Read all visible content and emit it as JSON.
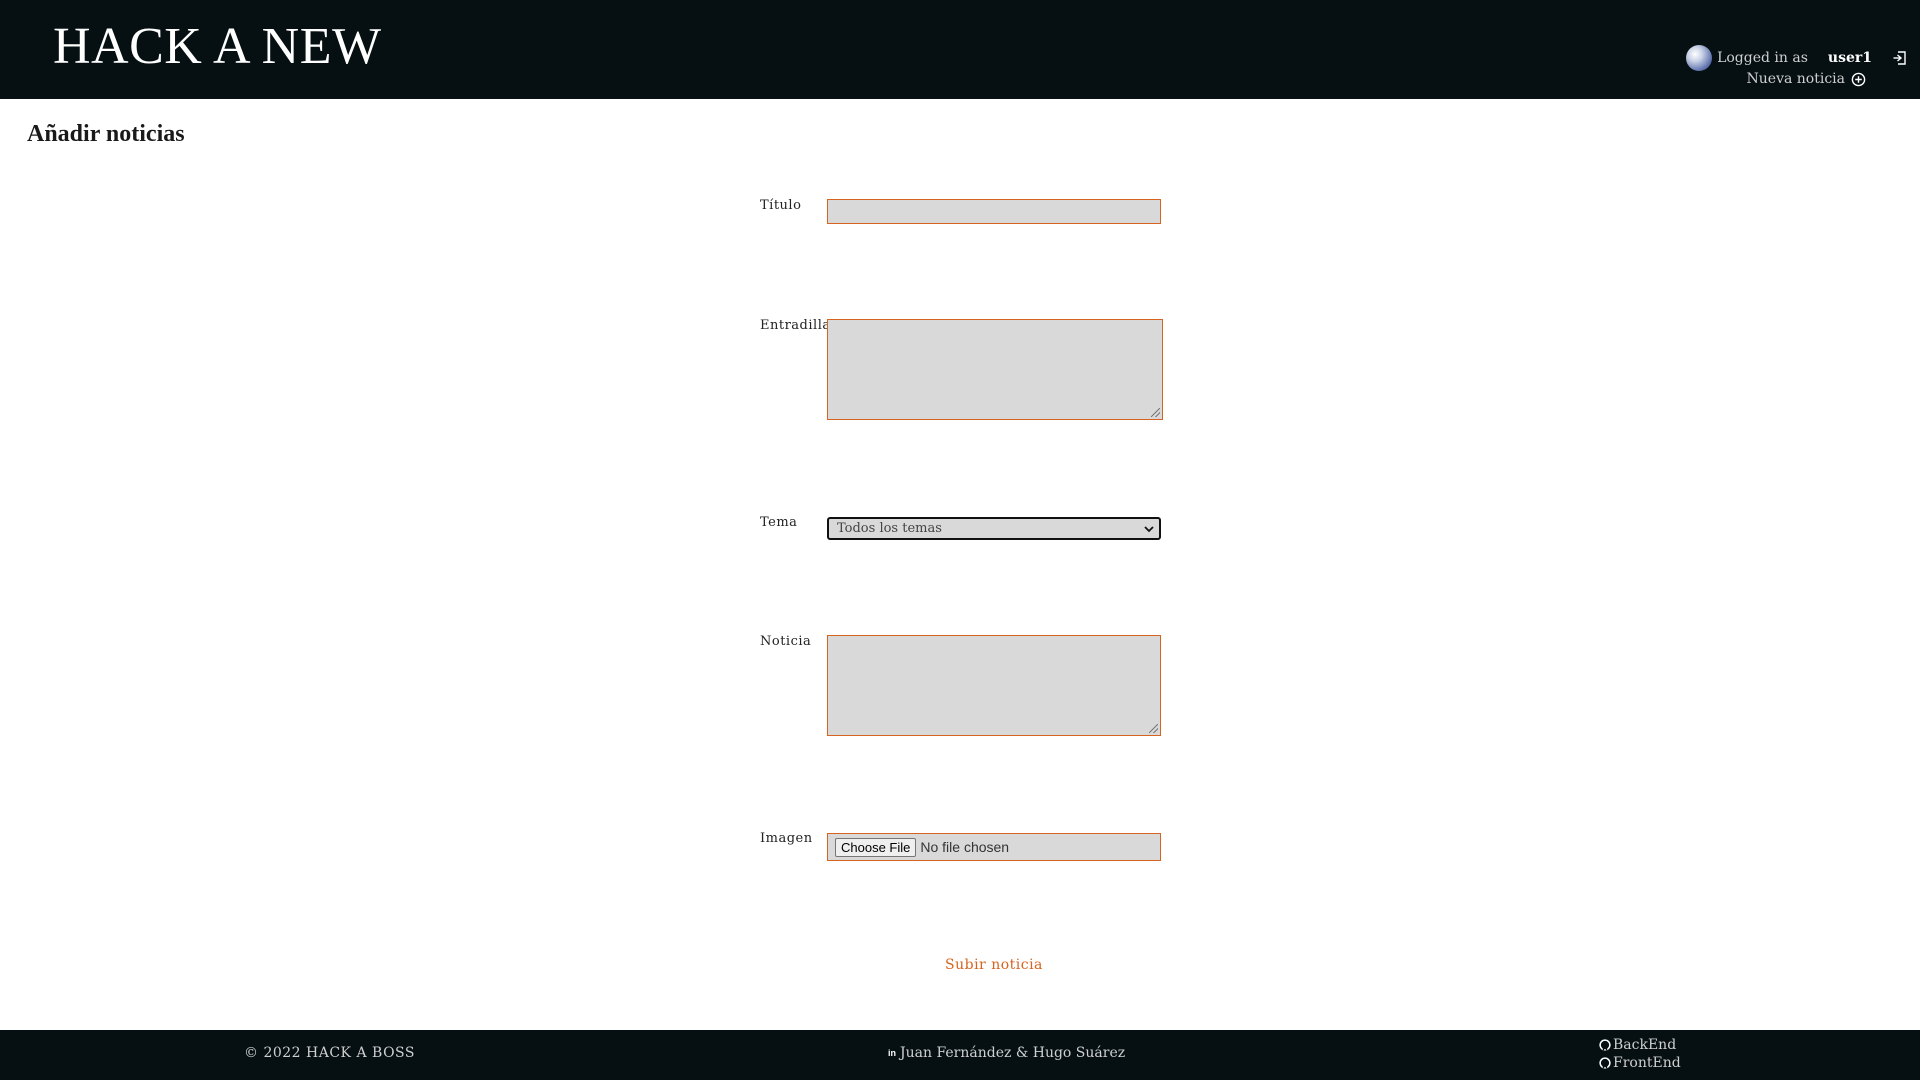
{
  "header": {
    "brand": "HACK A NEW",
    "logged_in_label": "Logged in as",
    "username": "user1",
    "new_news_label": "Nueva noticia",
    "icons": [
      "avatar",
      "logout-icon",
      "plus-circle-icon"
    ]
  },
  "page": {
    "title": "Añadir noticias"
  },
  "form": {
    "title_label": "Título",
    "title_value": "",
    "lead_label": "Entradilla",
    "lead_value": "",
    "topic_label": "Tema",
    "topic_selected": "Todos los temas",
    "body_label": "Noticia",
    "body_value": "",
    "image_label": "Imagen",
    "file_button_label": "Choose File",
    "file_status": "No file chosen",
    "submit_label": "Subir noticia"
  },
  "footer": {
    "copyright": "© 2022 HACK A BOSS",
    "linkedin_icon_text": "in",
    "authors": "Juan Fernández & Hugo Suárez",
    "backend_link": "BackEnd",
    "frontend_link": "FrontEnd"
  },
  "colors": {
    "header_bg": "#061012",
    "accent": "#d6631f",
    "input_bg": "#d9d9d9"
  }
}
